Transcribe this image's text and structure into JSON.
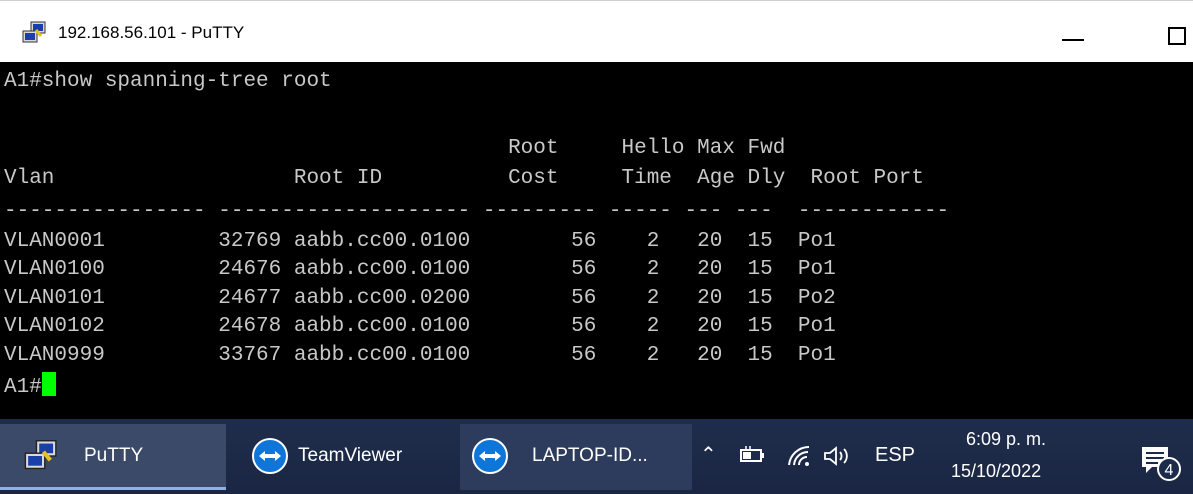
{
  "window": {
    "title": "192.168.56.101 - PuTTY"
  },
  "terminal": {
    "lines": [
      "A1#show spanning-tree root",
      "",
      "                                        Root     Hello Max Fwd",
      "Vlan                   Root ID          Cost     Time  Age Dly  Root Port",
      "---------------- -------------------- --------- ----- --- ---  ------------",
      "VLAN0001         32769 aabb.cc00.0100        56    2   20  15  Po1",
      "VLAN0100         24676 aabb.cc00.0100        56    2   20  15  Po1",
      "VLAN0101         24677 aabb.cc00.0200        56    2   20  15  Po2",
      "VLAN0102         24678 aabb.cc00.0100        56    2   20  15  Po1",
      "VLAN0999         33767 aabb.cc00.0100        56    2   20  15  Po1"
    ],
    "prompt": "A1#",
    "cursor_color": "#00ff00"
  },
  "taskbar": {
    "items": [
      {
        "label": "PuTTY",
        "icon": "putty-icon"
      },
      {
        "label": "TeamViewer",
        "icon": "teamviewer-icon"
      },
      {
        "label": "LAPTOP-ID...",
        "icon": "teamviewer-icon"
      }
    ],
    "tray": {
      "language": "ESP",
      "time": "6:09 p. m.",
      "date": "15/10/2022",
      "notification_count": "4"
    }
  },
  "colors": {
    "terminal_bg": "#000000",
    "terminal_text": "#c8c8c8",
    "taskbar_bg": "#1d2b4a"
  }
}
